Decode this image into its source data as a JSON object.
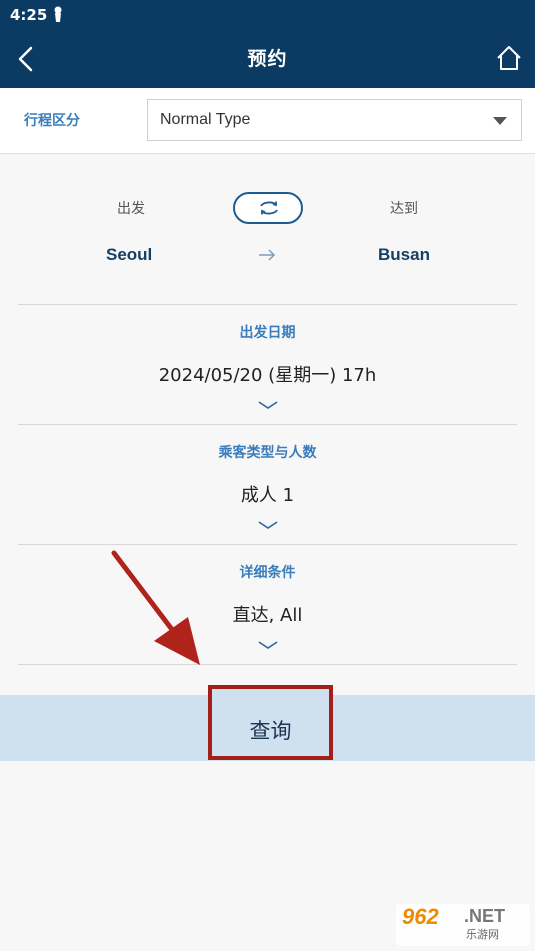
{
  "status_bar": {
    "time": "4:25"
  },
  "header": {
    "title": "预约"
  },
  "trip_type": {
    "label": "行程区分",
    "selected": "Normal Type"
  },
  "route": {
    "depart_label": "出发",
    "arrive_label": "达到",
    "from_city": "Seoul",
    "to_city": "Busan"
  },
  "departure_date": {
    "label": "出发日期",
    "value": "2024/05/20 (星期一) 17h"
  },
  "passengers": {
    "label": "乘客类型与人数",
    "value": "成人 1"
  },
  "details": {
    "label": "详细条件",
    "value": "直达, All"
  },
  "search": {
    "label": "查询"
  },
  "watermark": {
    "logo": "962",
    "net": ".NET",
    "sub": "乐游网"
  },
  "colors": {
    "header_bg": "#0b3a63",
    "accent": "#3a7dbd",
    "search_bg": "#cfe0ef",
    "highlight_red": "#a3201a"
  }
}
